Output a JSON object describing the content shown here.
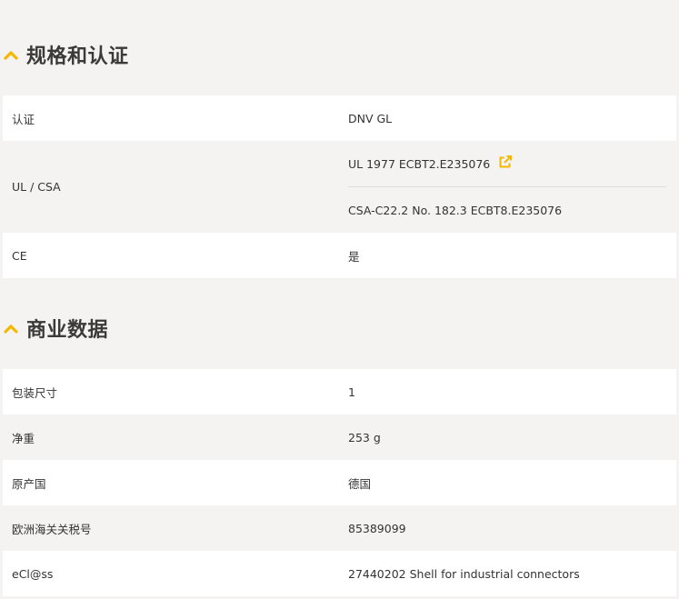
{
  "colors": {
    "accent": "#f5b800",
    "row_white": "#ffffff",
    "row_grey": "#f4f3f1"
  },
  "certifications": {
    "title": "规格和认证",
    "icon": "chevron-up-icon",
    "rows": [
      {
        "label": "认证",
        "value": "DNV GL"
      },
      {
        "label": "UL / CSA",
        "values": [
          {
            "text": "UL 1977 ECBT2.E235076",
            "icon": "external-link-icon"
          },
          {
            "text": "CSA-C22.2 No. 182.3 ECBT8.E235076"
          }
        ]
      },
      {
        "label": "CE",
        "value": "是"
      }
    ]
  },
  "commercial": {
    "title": "商业数据",
    "icon": "chevron-up-icon",
    "rows": [
      {
        "label": "包装尺寸",
        "value": "1"
      },
      {
        "label": "净重",
        "value": "253 g"
      },
      {
        "label": "原产国",
        "value": "德国"
      },
      {
        "label": "欧洲海关关税号",
        "value": "85389099"
      },
      {
        "label": "eCl@ss",
        "value": "27440202 Shell for industrial connectors"
      }
    ]
  }
}
